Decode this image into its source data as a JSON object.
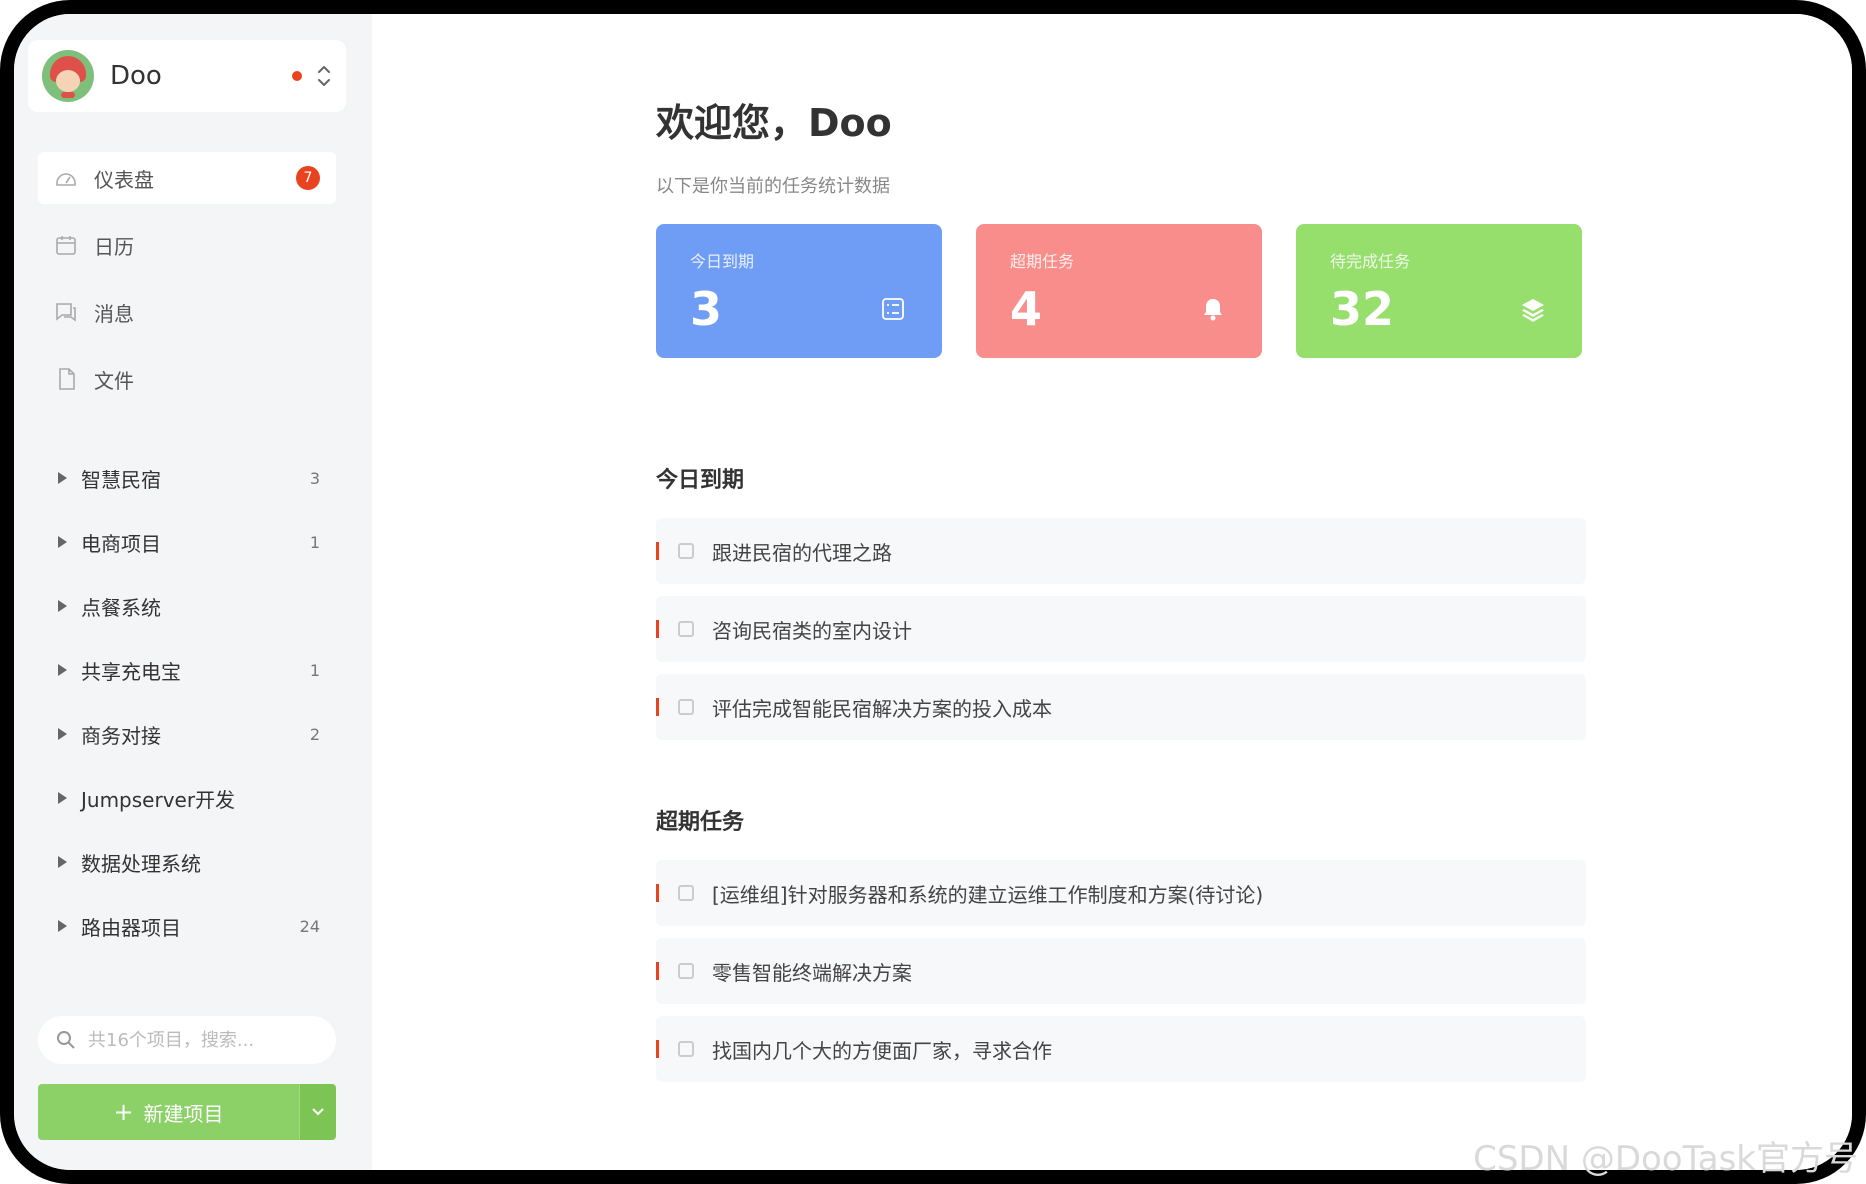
{
  "user": {
    "name": "Doo"
  },
  "nav": [
    {
      "label": "仪表盘",
      "icon": "dashboard-icon",
      "badge": "7",
      "active": true
    },
    {
      "label": "日历",
      "icon": "calendar-icon"
    },
    {
      "label": "消息",
      "icon": "message-icon"
    },
    {
      "label": "文件",
      "icon": "file-icon"
    }
  ],
  "projects": [
    {
      "label": "智慧民宿",
      "count": "3"
    },
    {
      "label": "电商项目",
      "count": "1"
    },
    {
      "label": "点餐系统",
      "count": ""
    },
    {
      "label": "共享充电宝",
      "count": "1"
    },
    {
      "label": "商务对接",
      "count": "2"
    },
    {
      "label": "Jumpserver开发",
      "count": ""
    },
    {
      "label": "数据处理系统",
      "count": ""
    },
    {
      "label": "路由器项目",
      "count": "24"
    }
  ],
  "search": {
    "placeholder": "共16个项目，搜索..."
  },
  "new_project": {
    "label": "新建项目"
  },
  "main": {
    "welcome": "欢迎您，Doo",
    "subtitle": "以下是你当前的任务统计数据"
  },
  "stats": [
    {
      "label": "今日到期",
      "value": "3",
      "color": "#6f9df5",
      "icon": "checklist-icon"
    },
    {
      "label": "超期任务",
      "value": "4",
      "color": "#f88d8b",
      "icon": "bell-icon"
    },
    {
      "label": "待完成任务",
      "value": "32",
      "color": "#96df6d",
      "icon": "layers-icon"
    }
  ],
  "today": {
    "title": "今日到期",
    "tasks": [
      "跟进民宿的代理之路",
      "咨询民宿类的室内设计",
      "评估完成智能民宿解决方案的投入成本"
    ]
  },
  "overdue": {
    "title": "超期任务",
    "tasks": [
      "[运维组]针对服务器和系统的建立运维工作制度和方案(待讨论)",
      "零售智能终端解决方案",
      "找国内几个大的方便面厂家，寻求合作"
    ]
  },
  "watermark": "CSDN @DooTask官方号"
}
